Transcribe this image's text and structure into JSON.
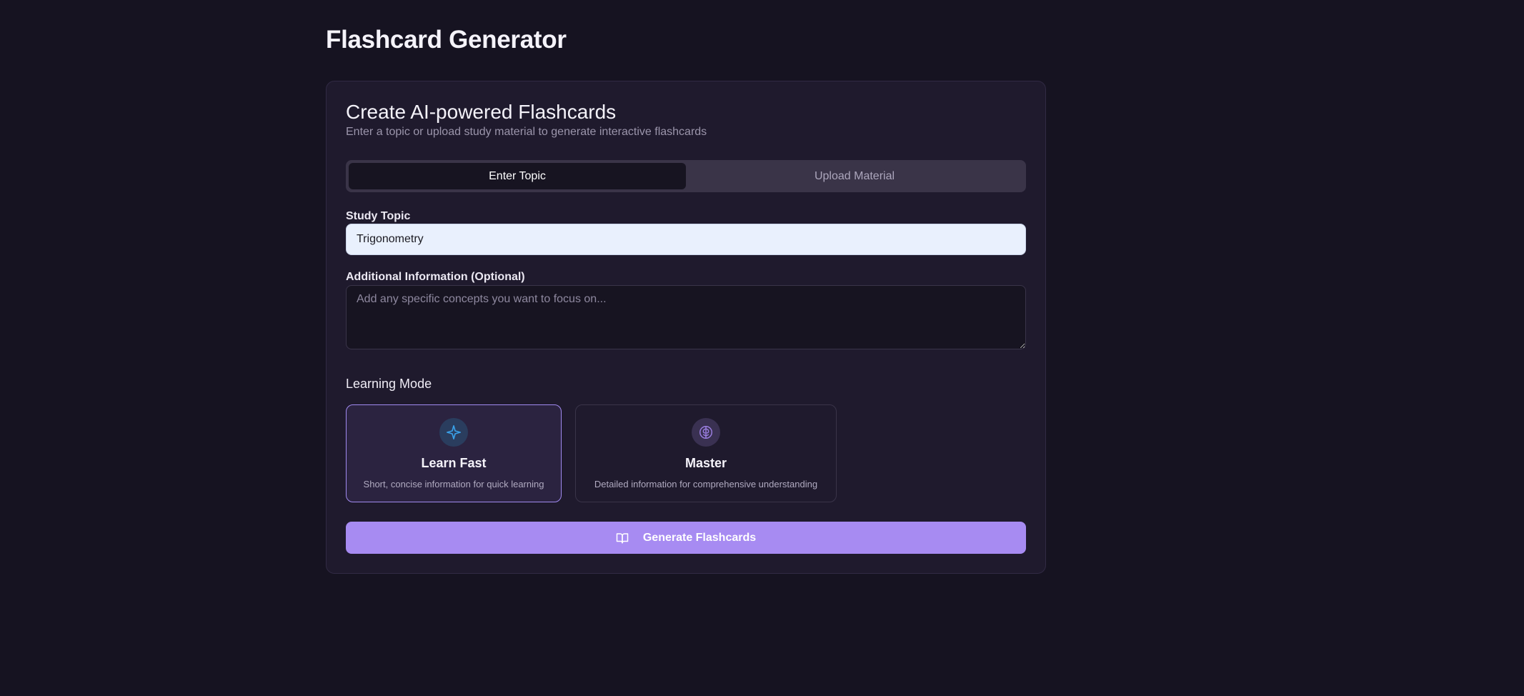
{
  "page": {
    "title": "Flashcard Generator"
  },
  "card": {
    "title": "Create AI-powered Flashcards",
    "subtitle": "Enter a topic or upload study material to generate interactive flashcards"
  },
  "tabs": [
    {
      "label": "Enter Topic",
      "active": true
    },
    {
      "label": "Upload Material",
      "active": false
    }
  ],
  "form": {
    "topic_label": "Study Topic",
    "topic_value": "Trigonometry",
    "info_label": "Additional Information (Optional)",
    "info_placeholder": "Add any specific concepts you want to focus on..."
  },
  "learning_mode": {
    "heading": "Learning Mode",
    "options": [
      {
        "title": "Learn Fast",
        "description": "Short, concise information for quick learning",
        "icon": "sparkle-icon",
        "selected": true
      },
      {
        "title": "Master",
        "description": "Detailed information for comprehensive understanding",
        "icon": "brain-icon",
        "selected": false
      }
    ]
  },
  "generate_button": {
    "label": "Generate Flashcards",
    "icon": "book-open-icon"
  },
  "colors": {
    "background": "#161321",
    "card": "#1f1a2d",
    "accent": "#a78bf2",
    "selected_border": "#a18af0",
    "sparkle_icon": "#3aa0e8",
    "brain_icon": "#9b7ee0"
  }
}
